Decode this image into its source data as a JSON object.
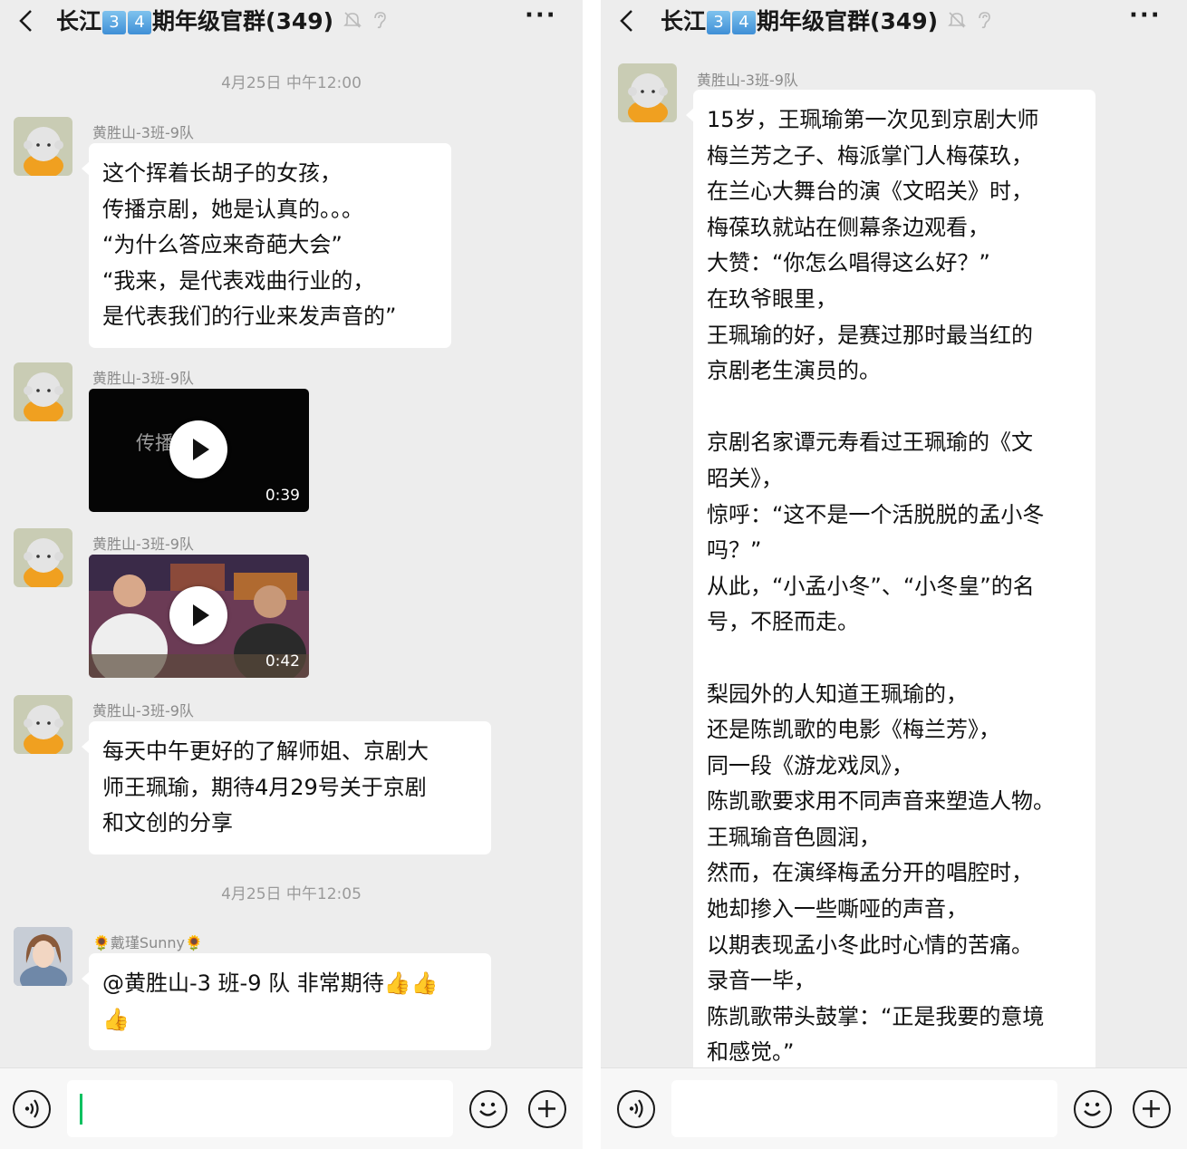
{
  "left": {
    "title": {
      "prefix": "长江",
      "d1": "3",
      "d2": "4",
      "suffix": "期年级官群(349)"
    },
    "messages": [
      {
        "timestamp": "4月25日 中午12:00"
      },
      {
        "sender": "黄胜山-3班-9队",
        "lines": [
          "这个挥着长胡子的女孩，",
          "传播京剧，她是认真的。。。",
          "“为什么答应来奇葩大会”",
          "“我来，是代表戏曲行业的，",
          "是代表我们的行业来发声音的”"
        ]
      },
      {
        "sender": "黄胜山-3班-9队",
        "video": {
          "overlay_text": "传播京剧",
          "duration": "0:39"
        }
      },
      {
        "sender": "黄胜山-3班-9队",
        "video": {
          "duration": "0:42"
        }
      },
      {
        "sender": "黄胜山-3班-9队",
        "lines": [
          "每天中午更好的了解师姐、京剧大",
          "师王珮瑜，期待4月29号关于京剧",
          "和文创的分享"
        ]
      },
      {
        "timestamp": "4月25日 中午12:05"
      },
      {
        "sender": "🌻戴瑾Sunny🌻",
        "lines": [
          "@黄胜山-3 班-9 队  非常期待👍👍",
          "👍"
        ]
      }
    ]
  },
  "right": {
    "title": {
      "prefix": "长江",
      "d1": "3",
      "d2": "4",
      "suffix": "期年级官群(349)"
    },
    "sender": "黄胜山-3班-9队",
    "lines": [
      "15岁，王珮瑜第一次见到京剧大师",
      "梅兰芳之子、梅派掌门人梅葆玖，",
      "在兰心大舞台的演《文昭关》时，",
      "梅葆玖就站在侧幕条边观看，",
      "大赞：“你怎么唱得这么好？”",
      "在玖爷眼里，",
      "王珮瑜的好，是赛过那时最当红的",
      "京剧老生演员的。",
      "",
      "京剧名家谭元寿看过王珮瑜的《文",
      "昭关》，",
      "惊呼：“这不是一个活脱脱的孟小冬",
      "吗？”",
      "从此，“小孟小冬”、“小冬皇”的名",
      "号，不胫而走。",
      "",
      "梨园外的人知道王珮瑜的，",
      "还是陈凯歌的电影《梅兰芳》，",
      "同一段《游龙戏凤》，",
      "陈凯歌要求用不同声音来塑造人物。",
      "王珮瑜音色圆润，",
      "然而，在演绎梅孟分开的唱腔时，",
      "她却掺入一些嘶哑的声音，",
      "以期表现孟小冬此时心情的苦痛。",
      "录音一毕，",
      "陈凯歌带头鼓掌：“正是我要的意境",
      "和感觉。”"
    ]
  },
  "icons": [
    "back-icon",
    "mute-icon",
    "ear-icon",
    "more-icon",
    "voice-icon",
    "emoji-icon",
    "plus-icon",
    "play-icon"
  ],
  "colors": {
    "background": "#ededed",
    "bubble": "#ffffff",
    "cursor": "#07c160",
    "badge": "#4a9de0"
  }
}
